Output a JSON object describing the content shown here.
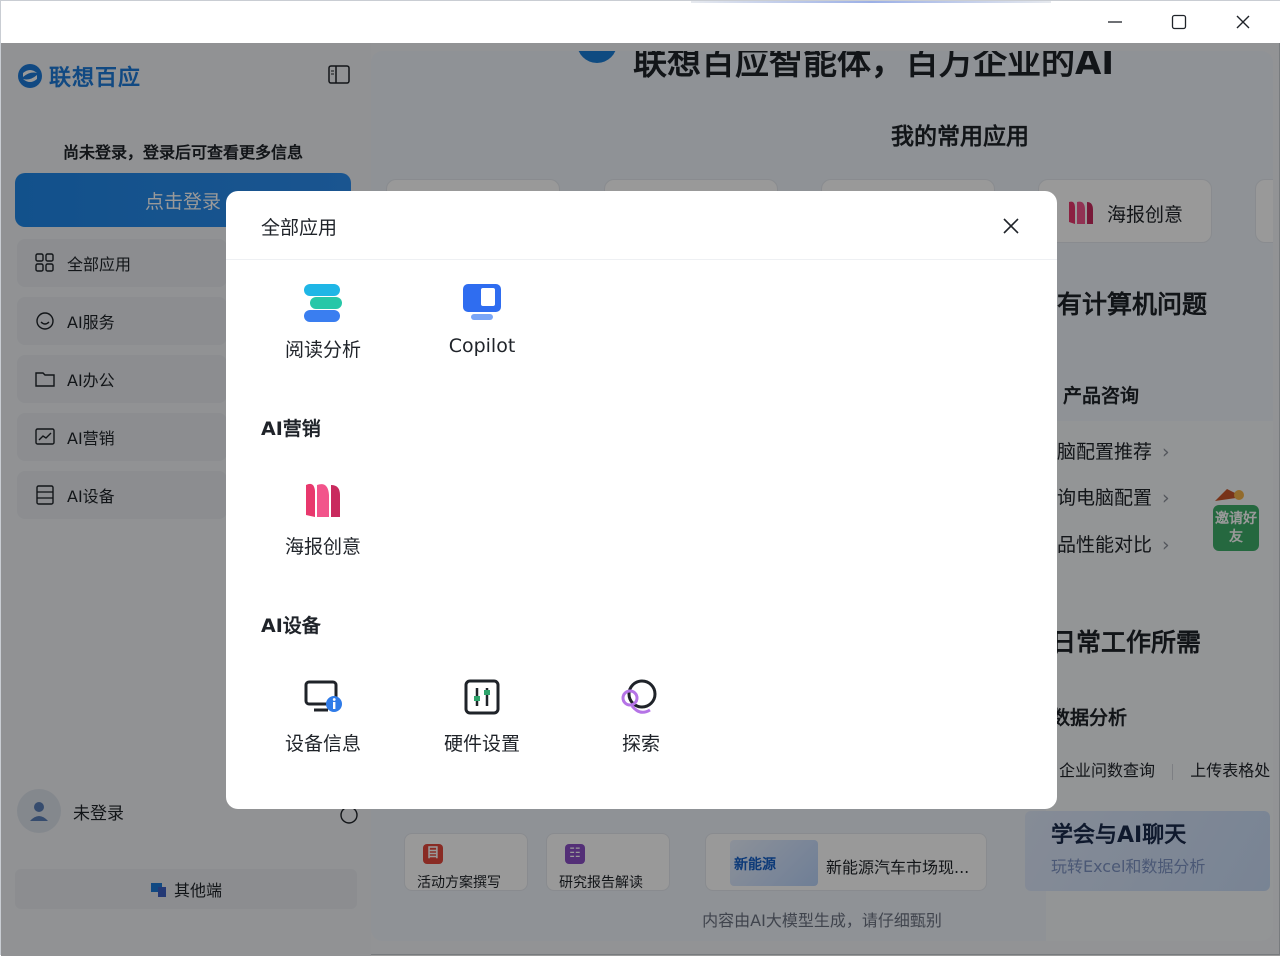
{
  "window": {
    "controls": {
      "minimize": "minimize-icon",
      "maximize": "maximize-icon",
      "close": "close-icon"
    }
  },
  "sidebar": {
    "logo_text": "联想百应",
    "login_hint": "尚未登录，登录后可查看更多信息",
    "login_button": "点击登录",
    "nav": [
      {
        "label": "全部应用",
        "icon": "grid-icon"
      },
      {
        "label": "AI服务",
        "icon": "service-icon"
      },
      {
        "label": "AI办公",
        "icon": "folder-icon"
      },
      {
        "label": "AI营销",
        "icon": "chart-icon"
      },
      {
        "label": "AI设备",
        "icon": "device-icon"
      }
    ],
    "user_name": "未登录",
    "other_button": "其他端"
  },
  "main": {
    "banner": "联想百应智能体，百万企业的AI",
    "favorites_title": "我的常用应用",
    "favorites": [
      {
        "label": "海报创意"
      }
    ],
    "section_computer": "有计算机问题",
    "product_consult": "产品咨询",
    "links": [
      "脑配置推荐",
      "询电脑配置",
      "品性能对比"
    ],
    "invite": "邀请好友",
    "section_daily": "日常工作所需",
    "data_analysis": "数据分析",
    "tabs": [
      "企业问数查询",
      "上传表格处"
    ],
    "promo_title": "学会与AI聊天",
    "promo_sub": "玩转Excel和数据分析",
    "small_cards": [
      {
        "label": "活动方案撰写",
        "icon_char": "目",
        "color": "#e5483d"
      },
      {
        "label": "研究报告解读",
        "icon_char": "☷",
        "color": "#8a4fc7"
      }
    ],
    "news_thumb": "新能源",
    "news_text": "新能源汽车市场现...",
    "disclaimer": "内容由AI大模型生成，请仔细甄别"
  },
  "modal": {
    "title": "全部应用",
    "close_icon": "close-icon",
    "groups": [
      {
        "title": "",
        "apps": [
          {
            "label": "阅读分析",
            "icon": "reading-analysis-icon"
          },
          {
            "label": "Copilot",
            "icon": "copilot-icon"
          }
        ]
      },
      {
        "title": "AI营销",
        "apps": [
          {
            "label": "海报创意",
            "icon": "poster-icon"
          }
        ]
      },
      {
        "title": "AI设备",
        "apps": [
          {
            "label": "设备信息",
            "icon": "device-info-icon"
          },
          {
            "label": "硬件设置",
            "icon": "hardware-settings-icon"
          },
          {
            "label": "探索",
            "icon": "explore-icon"
          }
        ]
      }
    ]
  }
}
